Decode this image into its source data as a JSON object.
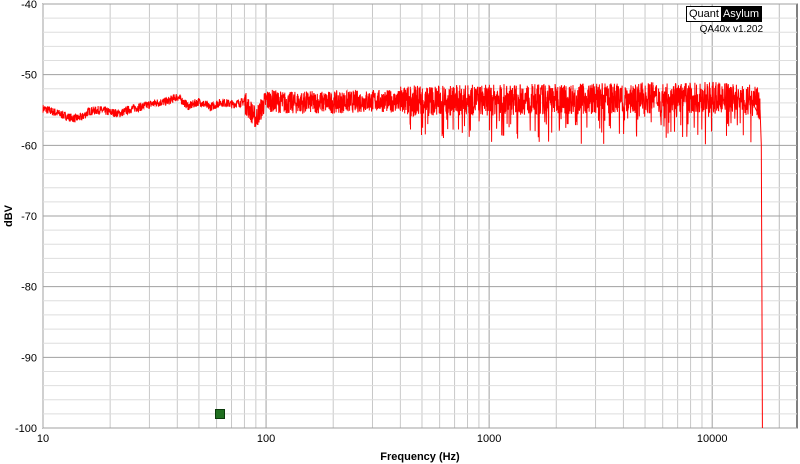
{
  "branding": {
    "logo_left": "Quant",
    "logo_right": "Asylum",
    "version": "QA40x v1.202"
  },
  "chart_data": {
    "type": "line",
    "title": "",
    "xlabel": "Frequency (Hz)",
    "ylabel": "dBV",
    "xscale": "log",
    "xlim": [
      10,
      24000
    ],
    "ylim": [
      -100,
      -40
    ],
    "x_ticks": [
      "10",
      "100",
      "1000",
      "10000"
    ],
    "y_ticks": [
      "-40",
      "-50",
      "-60",
      "-70",
      "-80",
      "-90",
      "-100"
    ],
    "grid": true,
    "colors": {
      "trace": "#ff0000",
      "grid": "#c8c8c8",
      "marker": "#1f6e1f"
    },
    "series": [
      {
        "x": [
          10,
          11,
          12,
          13,
          14,
          15,
          16,
          18,
          20,
          22,
          25,
          28,
          32,
          36,
          40,
          45,
          50,
          56,
          63,
          71,
          80,
          90,
          100,
          125,
          160,
          200,
          250,
          315,
          400,
          500,
          630,
          800,
          1000,
          1250,
          1600,
          2000,
          2500,
          3150,
          4000,
          5000,
          6300,
          8000,
          10000,
          12500,
          15000,
          16000,
          16400,
          16600,
          16700,
          16800
        ],
        "y": [
          -54.8,
          -55.2,
          -55.6,
          -56.0,
          -56.2,
          -56.0,
          -55.2,
          -55.0,
          -55.3,
          -55.5,
          -54.8,
          -54.5,
          -54.0,
          -53.8,
          -53.1,
          -54.5,
          -53.8,
          -54.6,
          -53.9,
          -54.2,
          -53.8,
          -56.2,
          -53.6,
          -54.0,
          -53.9,
          -53.9,
          -53.8,
          -53.7,
          -53.8,
          -53.6,
          -53.7,
          -53.6,
          -53.6,
          -53.5,
          -53.5,
          -53.4,
          -53.4,
          -53.4,
          -53.3,
          -53.3,
          -53.2,
          -53.3,
          -53.2,
          -53.4,
          -53.6,
          -54.0,
          -55.0,
          -60.0,
          -80.0,
          -100.0
        ]
      }
    ],
    "marker_point": {
      "x": 62,
      "y": -98
    }
  }
}
